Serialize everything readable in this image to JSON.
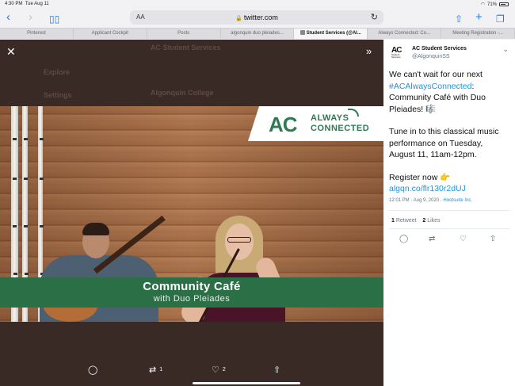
{
  "status_bar": {
    "time": "4:30 PM",
    "date": "Tue Aug 11",
    "battery": "71%"
  },
  "browser": {
    "url_aa": "AA",
    "url": "twitter.com",
    "tabs": [
      {
        "label": "Pinterest",
        "active": false
      },
      {
        "label": "Applicant Cockpit",
        "active": false
      },
      {
        "label": "Posts",
        "active": false
      },
      {
        "label": "algonquin duo pleiades...",
        "active": false
      },
      {
        "label": "Student Services (@Al...",
        "active": true
      },
      {
        "label": "Always Connected: Co...",
        "active": false
      },
      {
        "label": "Meeting Registration -...",
        "active": false
      }
    ]
  },
  "background_page": {
    "account_name": "AC Student Services",
    "menu_explore": "Explore",
    "menu_settings": "Settings",
    "college_name": "Algonquin College"
  },
  "media": {
    "ac_mark": "AC",
    "always": "ALWAYS",
    "connected": "CONNECTED",
    "banner_title": "Community Café",
    "banner_subtitle": "with Duo Pleiades",
    "retweet_count": "1",
    "like_count": "2"
  },
  "tweet": {
    "logo_text": "AC",
    "logo_small": "Student Services",
    "display_name": "AC Student Services",
    "handle": "@AlgonquinSS",
    "text_line1": "We can't wait for our next",
    "hashtag": "#ACAlwaysConnected",
    "text_line2": ": Community Café with Duo Pleiades! 🎼",
    "text_para2": "Tune in to this classical music performance on Tuesday, August 11, 11am-12pm.",
    "text_register": "Register now 👉",
    "link": "algqn.co/flr130r2dUJ",
    "timestamp": "12:01 PM · Aug 9, 2020 · ",
    "source": "Hootsuite Inc.",
    "retweets_count": "1",
    "retweets_label": "Retweet",
    "likes_count": "2",
    "likes_label": "Likes"
  },
  "colors": {
    "accent": "#1b95e0",
    "brand_green": "#2e7a52",
    "viewer_bg": "#3a2a26"
  }
}
